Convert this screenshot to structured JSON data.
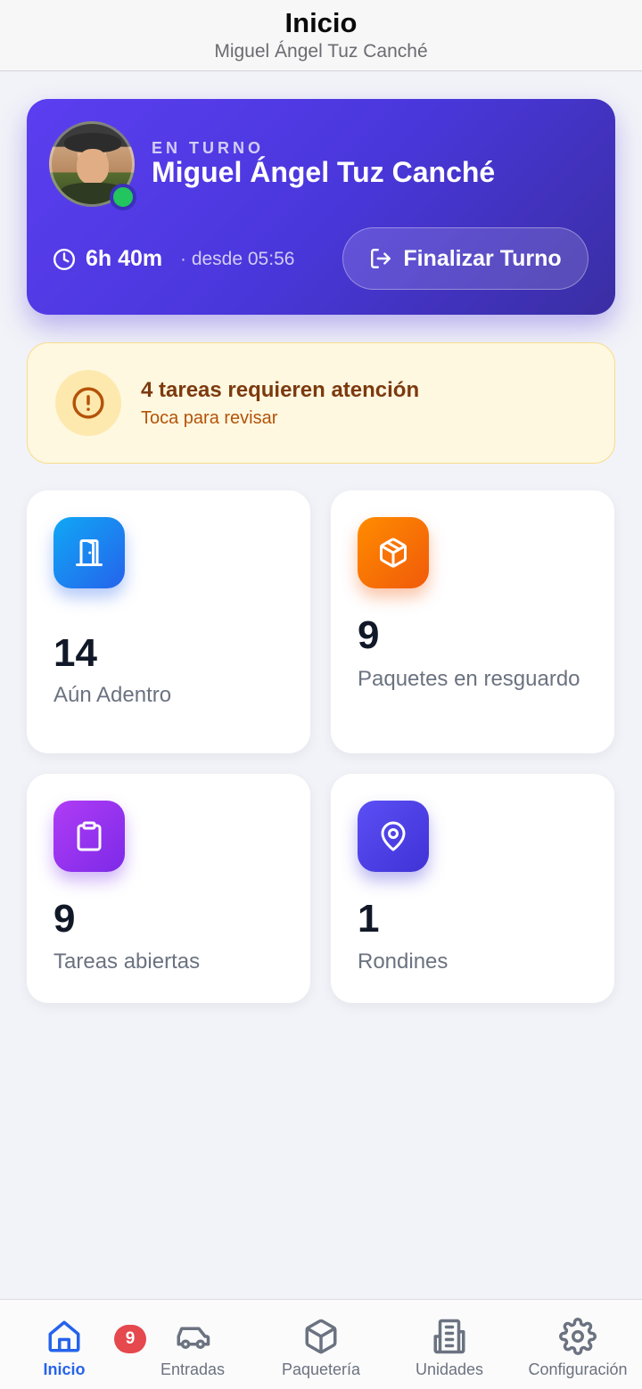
{
  "header": {
    "title": "Inicio",
    "subtitle": "Miguel Ángel Tuz Canché"
  },
  "shift": {
    "status_label": "EN TURNO",
    "guard_name": "Miguel Ángel Tuz Canché",
    "duration": "6h 40m",
    "since": "· desde 05:56",
    "end_button_label": "Finalizar Turno",
    "online_color": "#22c55e"
  },
  "alert": {
    "title": "4 tareas requieren atención",
    "subtitle": "Toca para revisar",
    "icon": "alert-circle-icon"
  },
  "stats": [
    {
      "value": "14",
      "label": "Aún Adentro",
      "icon": "door-icon",
      "color": "#2563eb"
    },
    {
      "value": "9",
      "label": "Paquetes en resguardo",
      "icon": "package-icon",
      "color": "#f05a0a"
    },
    {
      "value": "9",
      "label": "Tareas abiertas",
      "icon": "clipboard-icon",
      "color": "#7c2ae8"
    },
    {
      "value": "1",
      "label": "Rondines",
      "icon": "map-pin-icon",
      "color": "#3f33d6"
    }
  ],
  "nav": {
    "items": [
      {
        "label": "Inicio",
        "icon": "home-icon",
        "active": true
      },
      {
        "label": "Entradas",
        "icon": "car-icon",
        "badge": "9"
      },
      {
        "label": "Paquetería",
        "icon": "package-icon"
      },
      {
        "label": "Unidades",
        "icon": "building-icon"
      },
      {
        "label": "Configuración",
        "icon": "gear-icon"
      }
    ],
    "active_color": "#2563eb",
    "badge_color": "#e5484d"
  }
}
